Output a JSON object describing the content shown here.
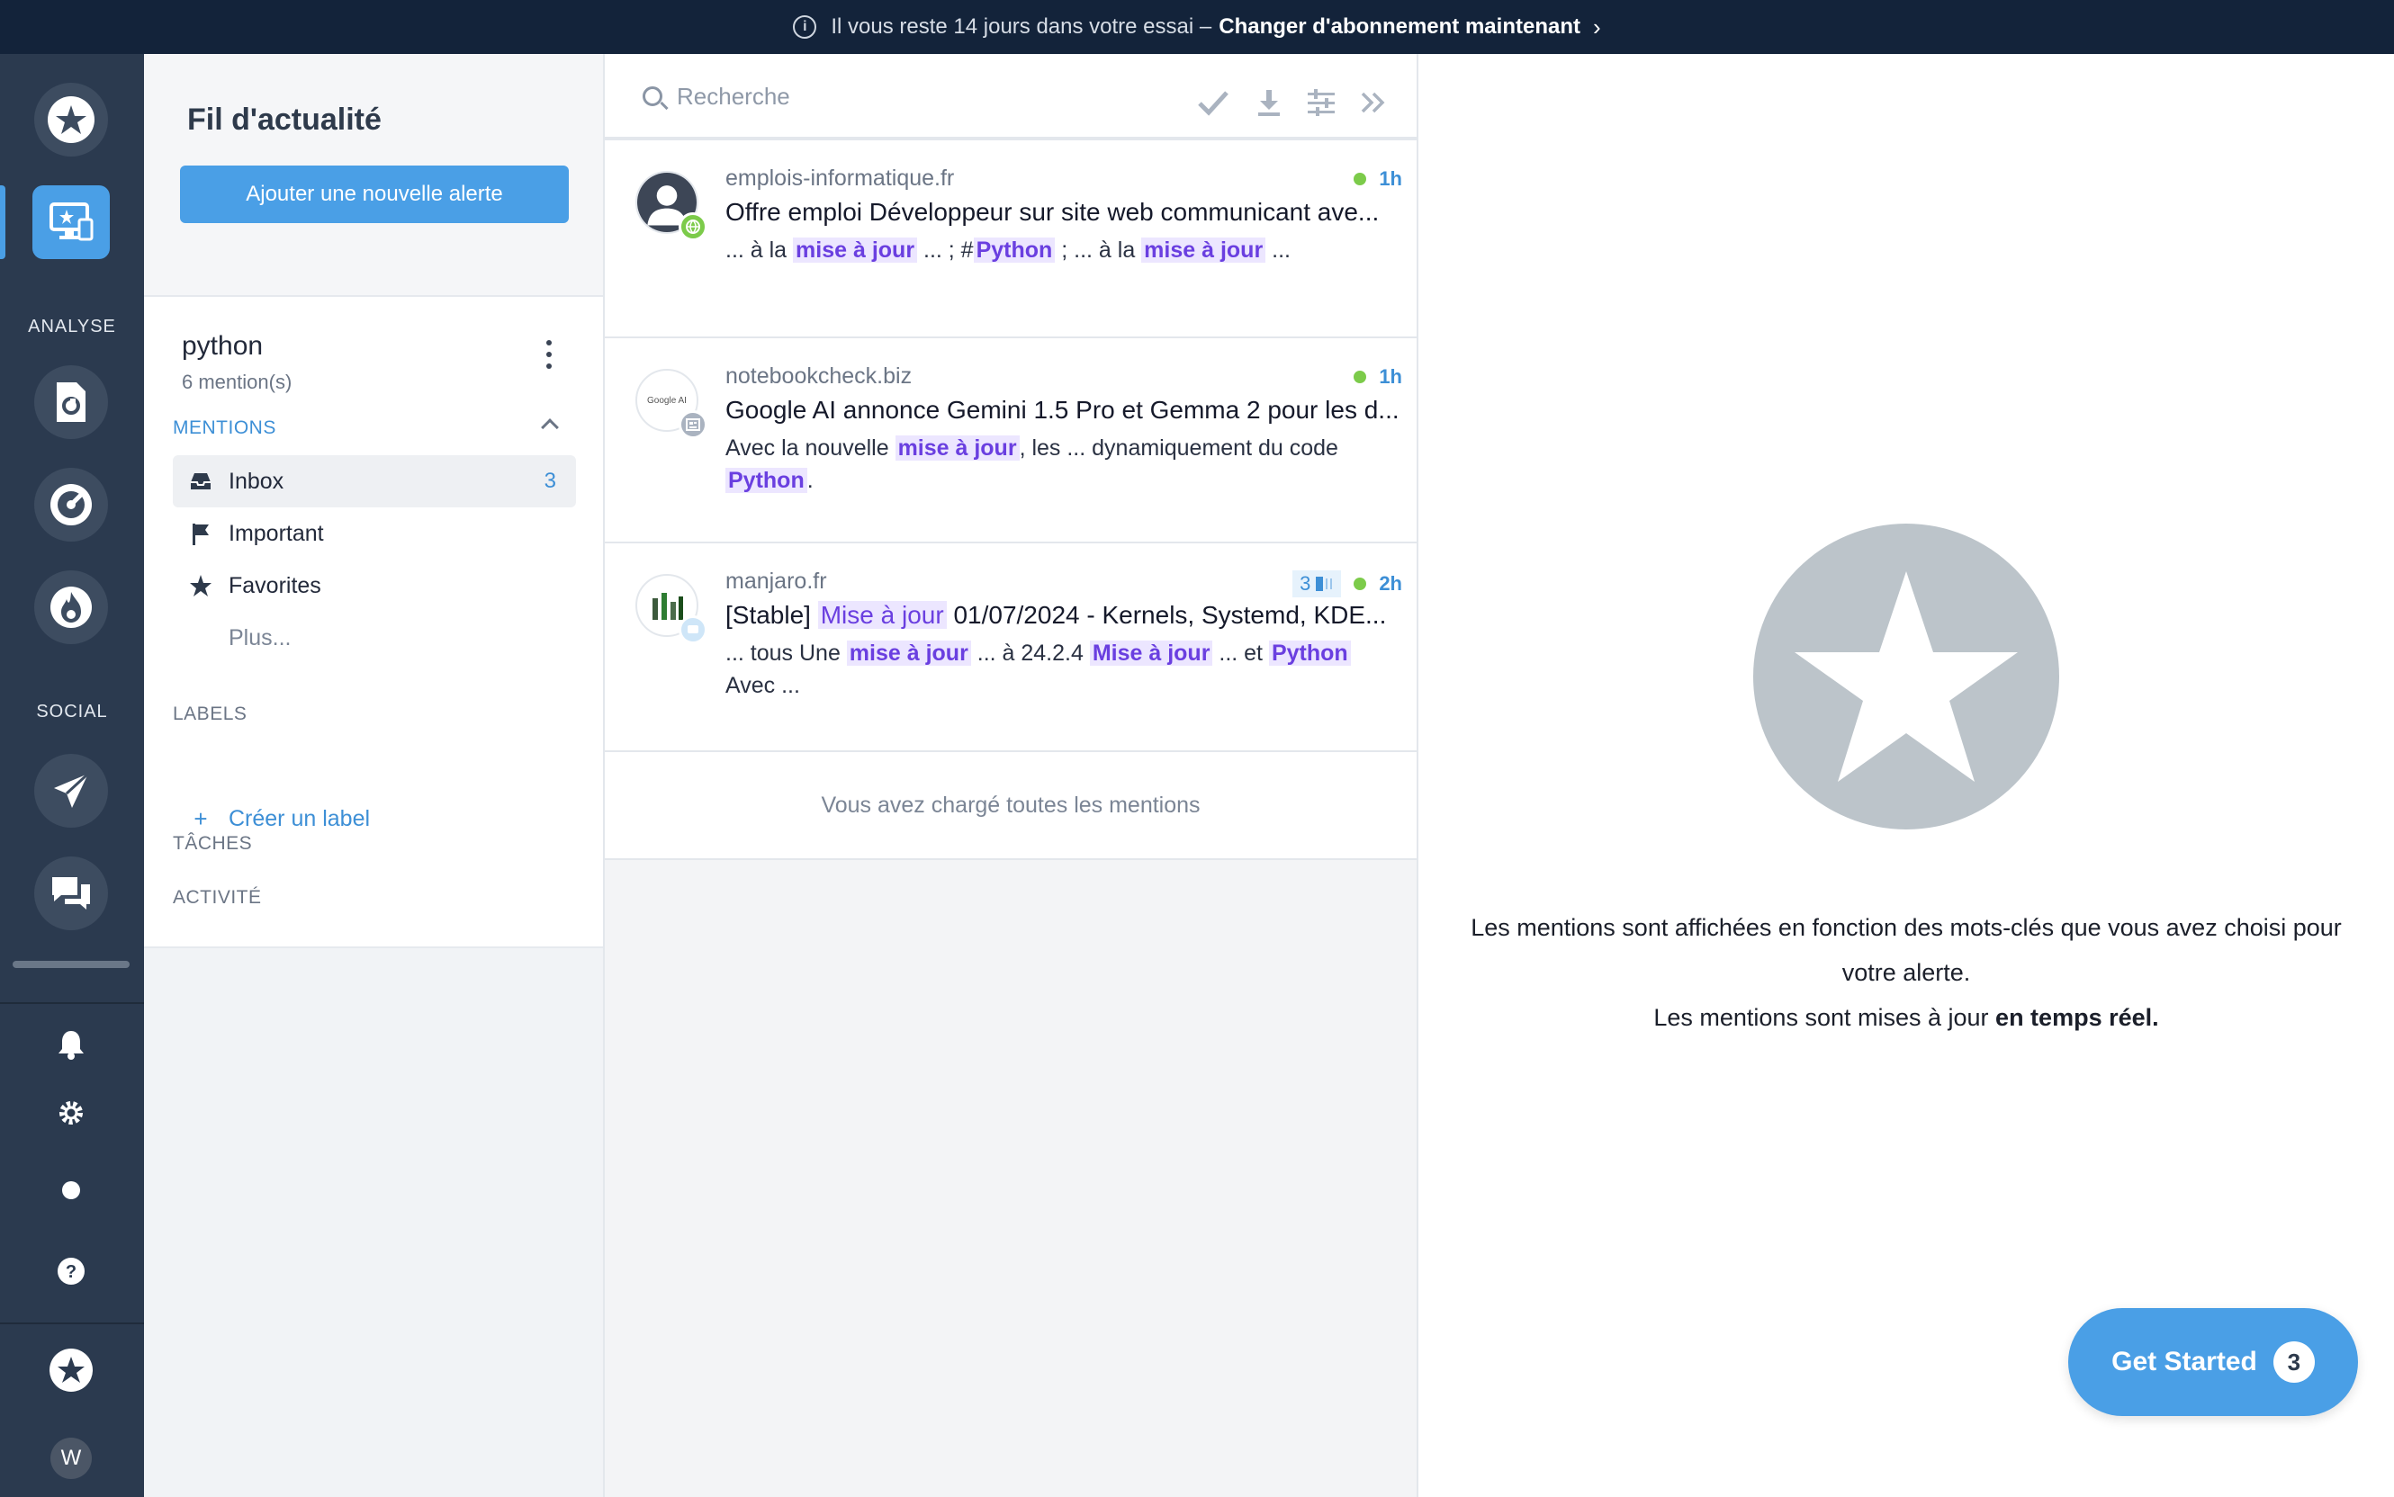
{
  "banner": {
    "info_icon": "info-icon",
    "text": "Il vous reste 14 jours dans votre essai –",
    "cta": "Changer d'abonnement maintenant"
  },
  "rail": {
    "sections": {
      "analyse": "ANALYSE",
      "social": "SOCIAL"
    },
    "avatar_letter": "W"
  },
  "sidebar": {
    "title": "Fil d'actualité",
    "add_alert": "Ajouter une nouvelle alerte",
    "alert_name": "python",
    "alert_mentions": "6 mention(s)",
    "mentions_header": "MENTIONS",
    "items": [
      {
        "label": "Inbox",
        "count": "3",
        "icon": "inbox-icon"
      },
      {
        "label": "Important",
        "icon": "flag-icon"
      },
      {
        "label": "Favorites",
        "icon": "star-icon"
      },
      {
        "label": "Plus..."
      }
    ],
    "labels_header": "LABELS",
    "create_label": "Créer un label",
    "tasks_header": "TÂCHES",
    "activity_header": "ACTIVITÉ"
  },
  "feed": {
    "search_placeholder": "Recherche",
    "loaded_text": "Vous avez chargé toutes les mentions",
    "cards": [
      {
        "source": "emplois-informatique.fr",
        "time": "1h",
        "title": "Offre emploi Développeur sur site web communicant ave...",
        "snippet": [
          "... à la ",
          "mise à jour",
          " ... ; #",
          "Python",
          " ; ... à la ",
          "mise à jour",
          " ..."
        ]
      },
      {
        "source": "notebookcheck.biz",
        "time": "1h",
        "avatar_text": "Google AI",
        "title": "Google AI annonce Gemini 1.5 Pro et Gemma 2 pour les d...",
        "snippet": [
          "Avec la nouvelle ",
          "mise à jour",
          ", les ... dynamiquement du code ",
          "Python",
          "."
        ]
      },
      {
        "source": "manjaro.fr",
        "time": "2h",
        "score": "3",
        "title_parts": [
          "[Stable] ",
          "Mise à jour",
          " 01/07/2024 - Kernels, Systemd, KDE..."
        ],
        "snippet": [
          "... tous Une ",
          "mise à jour",
          " ... à 24.2.4 ",
          "Mise à jour",
          " ... et ",
          "Python",
          " Avec ..."
        ]
      }
    ]
  },
  "right": {
    "line1": "Les mentions sont affichées en fonction des mots-clés que vous avez choisi pour votre alerte.",
    "line2_prefix": "Les mentions sont mises à jour ",
    "line2_bold": "en temps réel."
  },
  "get_started": {
    "label": "Get Started",
    "count": "3"
  },
  "colors": {
    "accent": "#4a9fe6",
    "rail": "#2b3a4f",
    "banner": "#13233a",
    "highlight": "#6a3fe0",
    "online": "#7ccb4a"
  }
}
